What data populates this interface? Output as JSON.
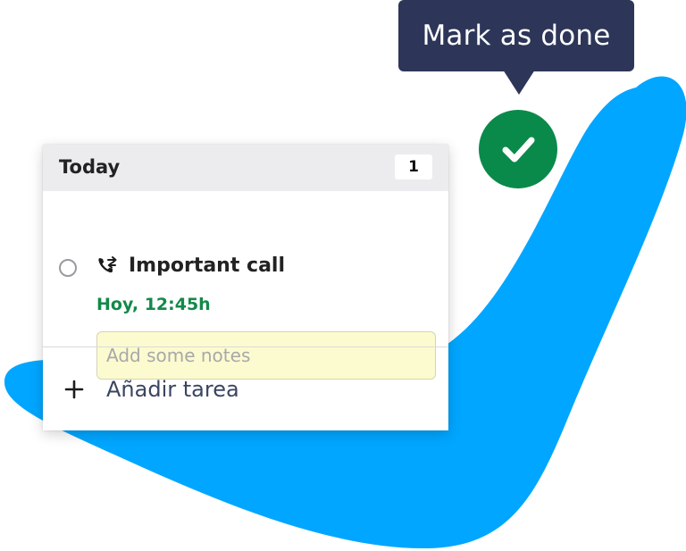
{
  "tooltip": {
    "text": "Mark as done"
  },
  "colors": {
    "accent_blue": "#00a6ff",
    "tooltip_bg": "#2d3658",
    "done_green": "#0a8a4a",
    "time_green": "#12894a",
    "notes_bg": "#fcfbd0"
  },
  "list": {
    "header_title": "Today",
    "count": "1",
    "task": {
      "icon": "phone-transfer-icon",
      "title": "Important call",
      "time": "Hoy, 12:45h",
      "notes_placeholder": "Add some notes",
      "notes_value": ""
    },
    "add_label": "Añadir tarea"
  }
}
